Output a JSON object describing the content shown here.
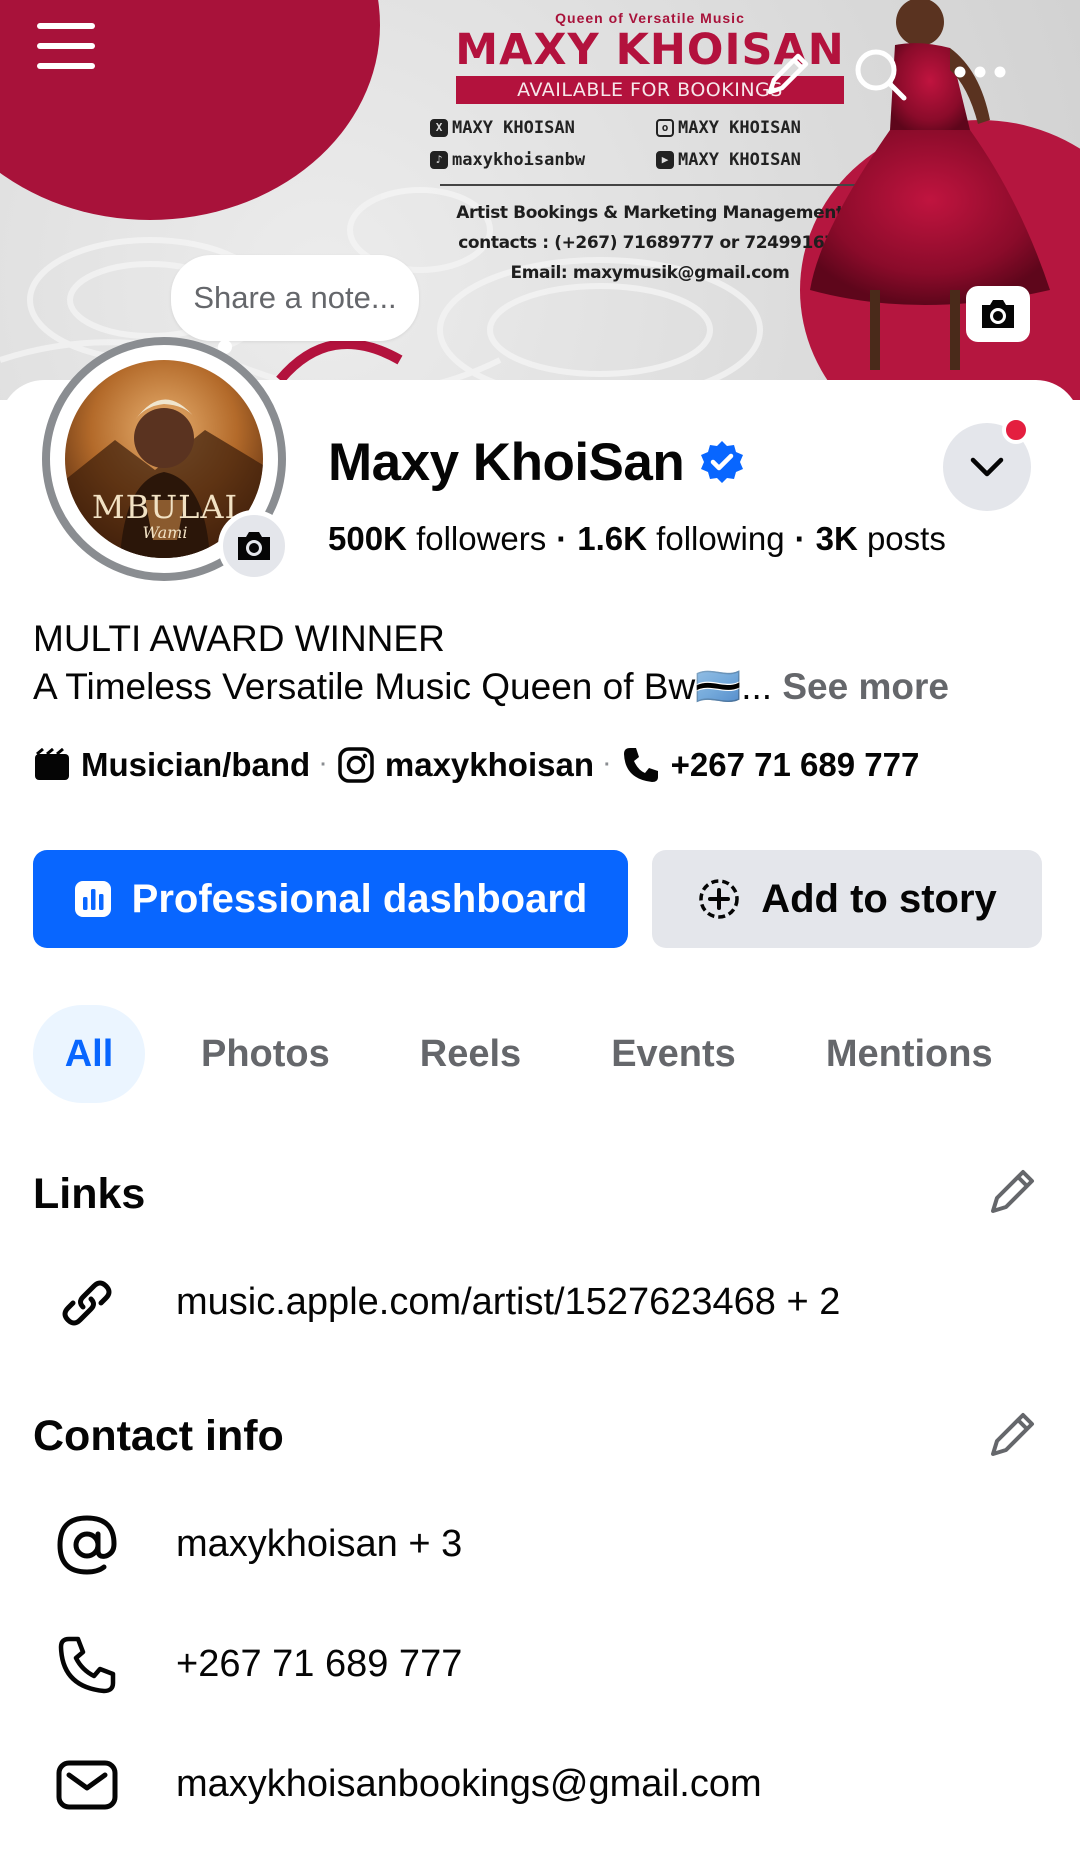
{
  "cover": {
    "tagline": "Queen of Versatile Music",
    "title": "MAXY KHOISAN",
    "banner": "AVAILABLE FOR BOOKINGS",
    "socials": [
      {
        "icon": "x-logo-icon",
        "label": "MAXY KHOISAN"
      },
      {
        "icon": "instagram-logo-icon",
        "label": "MAXY KHOISAN"
      },
      {
        "icon": "tiktok-logo-icon",
        "label": "maxykhoisanbw"
      },
      {
        "icon": "youtube-logo-icon",
        "label": "MAXY KHOISAN"
      }
    ],
    "contact_line1": "Artist Bookings & Marketing Management",
    "contact_line2": "contacts : (+267) 71689777 or 72499167.",
    "contact_line3": "Email: maxymusik@gmail.com",
    "accent_color": "#b3123d"
  },
  "note": {
    "placeholder": "Share a note..."
  },
  "avatar": {
    "caption": "MBULAI",
    "subcaption": "Wami"
  },
  "profile": {
    "name": "Maxy KhoiSan",
    "verified": true,
    "followers_count": "500K",
    "followers_label": "followers",
    "following_count": "1.6K",
    "following_label": "following",
    "posts_count": "3K",
    "posts_label": "posts",
    "bio_line1": "MULTI AWARD WINNER",
    "bio_line2": "A Timeless Versatile Music Queen of Bw🇧🇼...",
    "see_more": "See more",
    "category": "Musician/band",
    "instagram": "maxykhoisan",
    "phone": "+267 71 689 777"
  },
  "actions": {
    "dashboard_label": "Professional dashboard",
    "story_label": "Add to story",
    "primary_color": "#0866ff"
  },
  "tabs": [
    {
      "label": "All",
      "active": true
    },
    {
      "label": "Photos",
      "active": false
    },
    {
      "label": "Reels",
      "active": false
    },
    {
      "label": "Events",
      "active": false
    },
    {
      "label": "Mentions",
      "active": false
    }
  ],
  "links": {
    "title": "Links",
    "url": "music.apple.com/artist/1527623468 + 2"
  },
  "contact_info": {
    "title": "Contact info",
    "username": "maxykhoisan + 3",
    "phone": "+267 71 689 777",
    "email": "maxykhoisanbookings@gmail.com"
  }
}
